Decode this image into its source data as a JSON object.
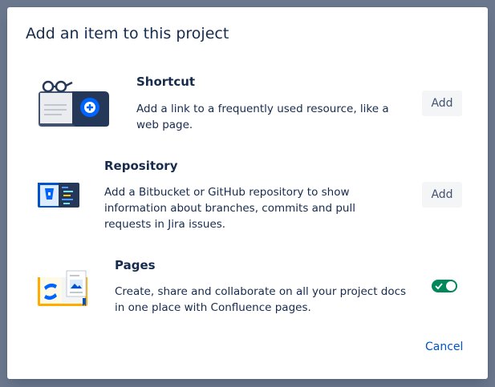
{
  "dialog": {
    "title": "Add an item to this project",
    "items": [
      {
        "title": "Shortcut",
        "description": "Add a link to a frequently used resource, like a web page.",
        "action_label": "Add",
        "illustration": "book-with-glasses-and-plus-icon"
      },
      {
        "title": "Repository",
        "description": "Add a Bitbucket or GitHub repository to show information about branches, commits and pull requests in Jira issues.",
        "action_label": "Add",
        "illustration": "book-with-bitbucket-and-code-icon"
      },
      {
        "title": "Pages",
        "description": "Create, share and collaborate on all your project docs in one place with Confluence pages.",
        "toggle_state": "on",
        "illustration": "book-with-confluence-and-image-icon"
      }
    ],
    "cancel_label": "Cancel",
    "colors": {
      "primary": "#0052cc",
      "toggle_on": "#00875a",
      "text": "#172b4d",
      "button_bg": "#f4f5f7"
    }
  }
}
